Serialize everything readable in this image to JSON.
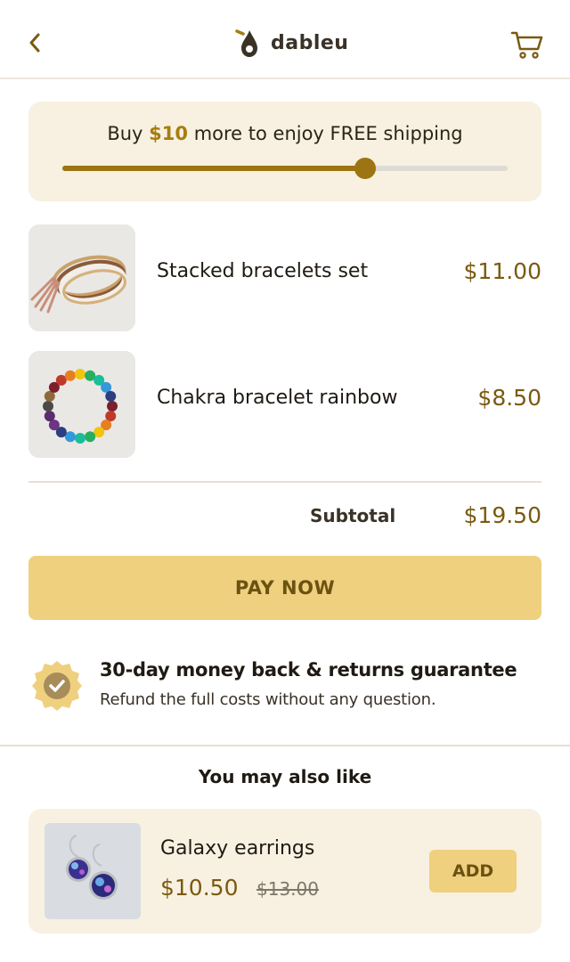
{
  "header": {
    "brand": "dableu",
    "back_icon": "chevron-left-icon",
    "cart_icon": "cart-icon",
    "accent_color": "#9c7412"
  },
  "shipping": {
    "prefix": "Buy ",
    "amount": "$10",
    "suffix": " more to enjoy FREE shipping",
    "progress": 0.68
  },
  "cart": {
    "items": [
      {
        "name": "Stacked bracelets set",
        "price": "$11.00"
      },
      {
        "name": "Chakra bracelet rainbow",
        "price": "$8.50"
      }
    ],
    "subtotal_label": "Subtotal",
    "subtotal_value": "$19.50"
  },
  "checkout": {
    "pay_label": "PAY NOW",
    "button_color": "#efd07f"
  },
  "guarantee": {
    "title": "30-day money back & returns guarantee",
    "subtitle": "Refund the full costs without any question.",
    "icon": "badge-check-icon"
  },
  "recommendations": {
    "heading": "You may also like",
    "items": [
      {
        "name": "Galaxy earrings",
        "price": "$10.50",
        "old_price": "$13.00",
        "add_label": "ADD"
      }
    ]
  }
}
